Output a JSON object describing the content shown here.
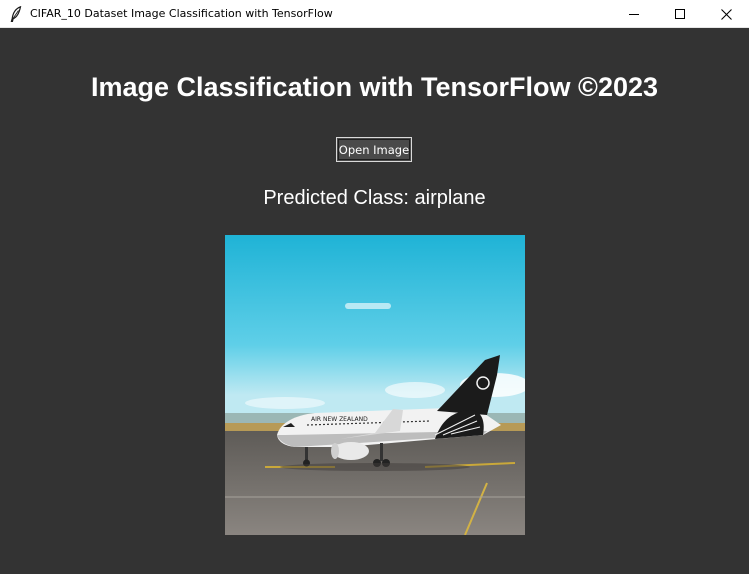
{
  "window": {
    "title": "CIFAR_10 Dataset Image Classification with TensorFlow",
    "icon": "feather-icon",
    "controls": [
      "minimize-icon",
      "maximize-icon",
      "close-icon"
    ]
  },
  "main": {
    "heading": "Image Classification with TensorFlow ©2023",
    "open_button_label": "Open Image",
    "prediction_text": "Predicted Class: airplane",
    "image_livery_text": "AIR NEW ZEALAND"
  },
  "colors": {
    "background": "#333333",
    "text": "#ffffff",
    "sky": "#35b8db",
    "tarmac": "#6d6a66"
  }
}
